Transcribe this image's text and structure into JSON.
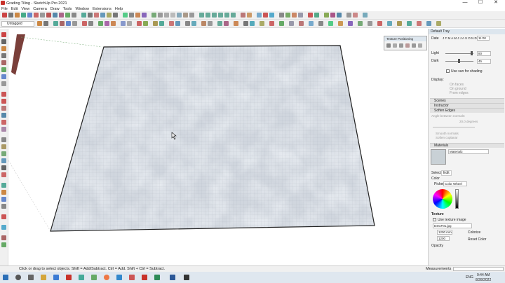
{
  "window": {
    "title": "Grading Tiling - SketchUp Pro 2021",
    "min": "—",
    "max": "☐",
    "close": "✕"
  },
  "menu": [
    "File",
    "Edit",
    "View",
    "Camera",
    "Draw",
    "Tools",
    "Window",
    "Extensions",
    "Help"
  ],
  "toolbar": {
    "tag_dropdown": "Untagged"
  },
  "texture_positioning": {
    "title": "Texture Positioning"
  },
  "default_tray": {
    "title": "Default Tray",
    "date_label": "Date",
    "months": "J F M A M J J A S O N D",
    "time_value": "11:00",
    "light_label": "Light",
    "light_value": "80",
    "dark_label": "Dark",
    "dark_value": "45",
    "use_sun_label": "Use sun for shading",
    "display_label": "Display:",
    "on_faces": "On faces",
    "on_ground": "On ground",
    "from_edges": "From edges",
    "scenes": "Scenes",
    "instructor": "Instructor",
    "soften_edges": "Soften Edges",
    "angle_label": "Angle between normals:",
    "angle_value": "20.0  degrees",
    "smooth_normals": "Smooth normals",
    "soften_coplanar": "Soften coplanar",
    "materials": "Materials",
    "material_name": "Material3",
    "tab_select": "Select",
    "tab_edit": "Edit",
    "color_label": "Color",
    "picker_label": "Picker:",
    "picker_value": "Color Wheel",
    "texture_label": "Texture",
    "use_texture_label": "Use texture image",
    "texture_file": "DSCF01.jpg",
    "tex_width": "1200 mm",
    "tex_height": "1200",
    "colorize": "Colorize",
    "reset_color": "Reset Color",
    "opacity_label": "Opacity"
  },
  "status": {
    "hint": "Click or drag to select objects. Shift = Add/Subtract. Ctrl = Add. Shift + Ctrl = Subtract.",
    "measurements_label": "Measurements"
  },
  "taskbar": {
    "time": "9:44 AM",
    "date": "8/28/2022",
    "lang": "ENG"
  }
}
